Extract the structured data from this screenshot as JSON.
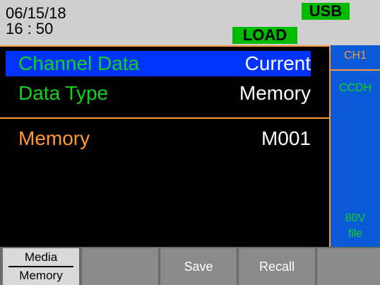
{
  "status": {
    "date": "06/15/18",
    "time": "16 : 50",
    "usb_badge": "USB",
    "load_badge": "LOAD",
    "badge_color": "#00bb00"
  },
  "menu": {
    "rows": [
      {
        "label": "Channel Data",
        "value": "Current"
      },
      {
        "label": "Data Type",
        "value": "Memory"
      },
      {
        "label": "Memory",
        "value": "M001"
      }
    ],
    "selected_color": "#0033ff",
    "label_color_green": "#12d21a",
    "label_color_orange": "#ff9933"
  },
  "side_panel": {
    "channel": "CH1",
    "mode": "CCDH",
    "voltage": "80V",
    "source": "file"
  },
  "softkeys": {
    "media_top": "Media",
    "media_bottom": "Memory",
    "save": "Save",
    "recall": "Recall"
  }
}
